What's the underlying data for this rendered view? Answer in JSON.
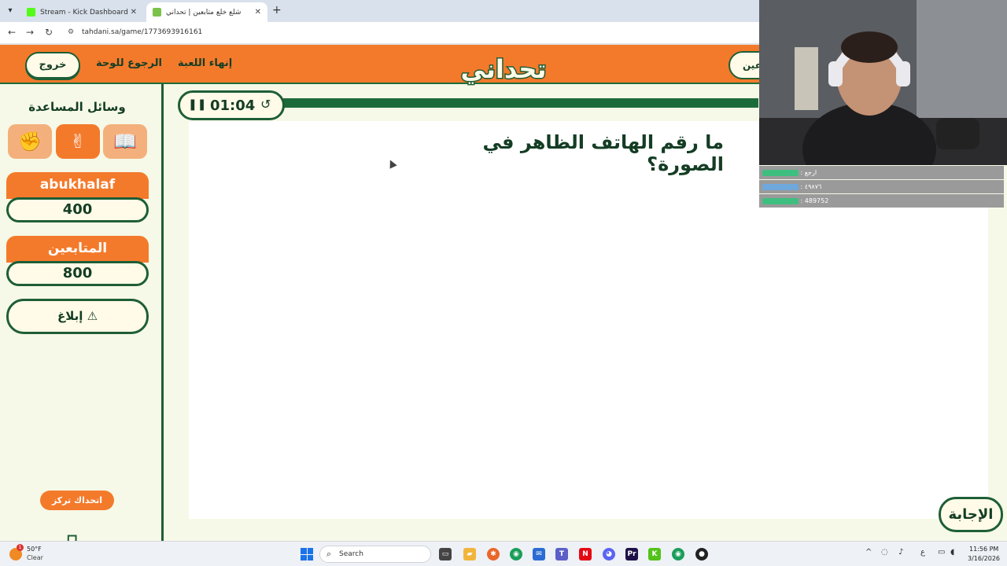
{
  "browser": {
    "tabs": [
      {
        "label": "Stream - Kick Dashboard",
        "favicon_color": "#53fc18"
      },
      {
        "label": "شلع خلع متابعين | تحداني",
        "favicon_color": "#7bc24a"
      }
    ],
    "url": "tahdani.sa/game/1773693916161"
  },
  "header": {
    "exit_label": "خروج",
    "back_label": "الرجوع للوحة",
    "end_label": "إنهاء اللعبة",
    "right_pill_label": "عين",
    "logo_text": "تحداني"
  },
  "sidebar": {
    "aids_title": "وسائل المساعدة",
    "aids": [
      "fist-icon",
      "victory-hand-icon",
      "book-icon"
    ],
    "teams": [
      {
        "name": "abukhalaf",
        "score": "400"
      },
      {
        "name": "المتابعين",
        "score": "800"
      }
    ],
    "report_label": "إبلاغ ⚠",
    "challenge_label": "اتحداك تركز",
    "logo_text": "تحداني"
  },
  "game": {
    "timer": "01:04",
    "question": "ما رقم الهاتف الظاهر في الصورة؟",
    "answer_label": "الإجابة"
  },
  "chat": {
    "messages": [
      {
        "text": ": ارجع",
        "user_color": "#3fbf7f"
      },
      {
        "text": ": ٤٩٨٧٦",
        "user_color": "#6fa8dc"
      },
      {
        "text": ": 489752",
        "user_color": "#3fbf7f"
      }
    ]
  },
  "taskbar": {
    "weather_temp": "50°F",
    "weather_desc": "Clear",
    "weather_badge": "1",
    "search_label": "Search",
    "time": "11:56 PM",
    "date": "3/16/2026",
    "lang": "ع"
  },
  "colors": {
    "brand_orange": "#f47a2b",
    "brand_green": "#1e5e36",
    "page_bg": "#f6f9e7"
  }
}
